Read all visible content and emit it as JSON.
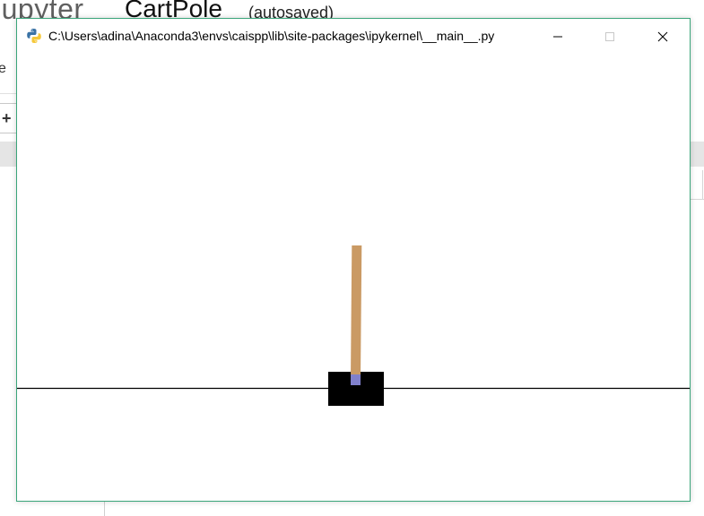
{
  "background_page": {
    "logo_text": "jupyter",
    "notebook_name": "CartPole",
    "autosave_status": "(autosaved)",
    "menu_fragment": "e",
    "toolbar_fragment": "+"
  },
  "window": {
    "title": "C:\\Users\\adina\\Anaconda3\\envs\\caispp\\lib\\site-packages\\ipykernel\\__main__.py",
    "app_icon": "python-icon",
    "controls": {
      "minimize_icon": "minimize-icon",
      "maximize_icon": "maximize-icon",
      "close_icon": "close-icon"
    },
    "accent_border_color": "#3aa57a"
  },
  "cartpole_scene": {
    "cart_color": "#000000",
    "pole_color": "#ca9a64",
    "axle_color": "#8080cc",
    "track_color": "#000000",
    "background_color": "#ffffff",
    "pole_angle_deg": 0.5
  }
}
